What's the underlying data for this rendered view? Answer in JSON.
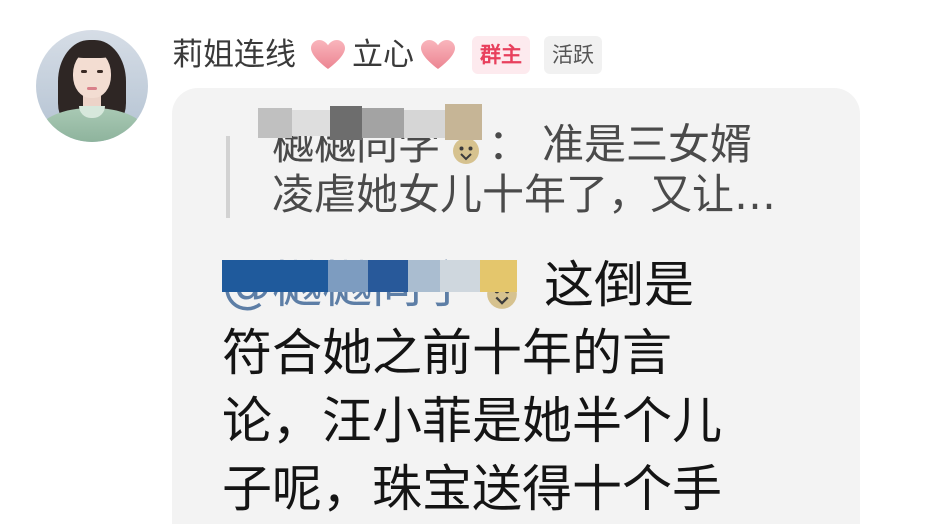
{
  "user": {
    "name": "莉姐连线",
    "name_suffix": "立心",
    "badges": [
      "群主",
      "活跃"
    ]
  },
  "message": {
    "quote": {
      "author": "樾樾同学",
      "separator": "：",
      "lines": [
        "准是三女婿",
        "凌虐她女儿十年了，又让…"
      ]
    },
    "mention": "@樾樾同学",
    "lines": [
      "这倒是",
      "符合她之前十年的言",
      "论，汪小菲是她半个儿",
      "子呢，珠宝送得十个手"
    ]
  },
  "icons": {
    "name_decoration": "heart-icon",
    "inline_emoji": "emoji-icon"
  },
  "colors": {
    "bubble_background": "#f3f3f3",
    "owner_badge_background": "#fdeaee",
    "owner_badge_text": "#e8405d",
    "active_badge_background": "#f1f1f1",
    "active_badge_text": "#555555",
    "name_text": "#3a3a3a",
    "quote_text": "#4a4a4a",
    "message_text": "#141414",
    "mention_text": "#5d7ea6"
  }
}
